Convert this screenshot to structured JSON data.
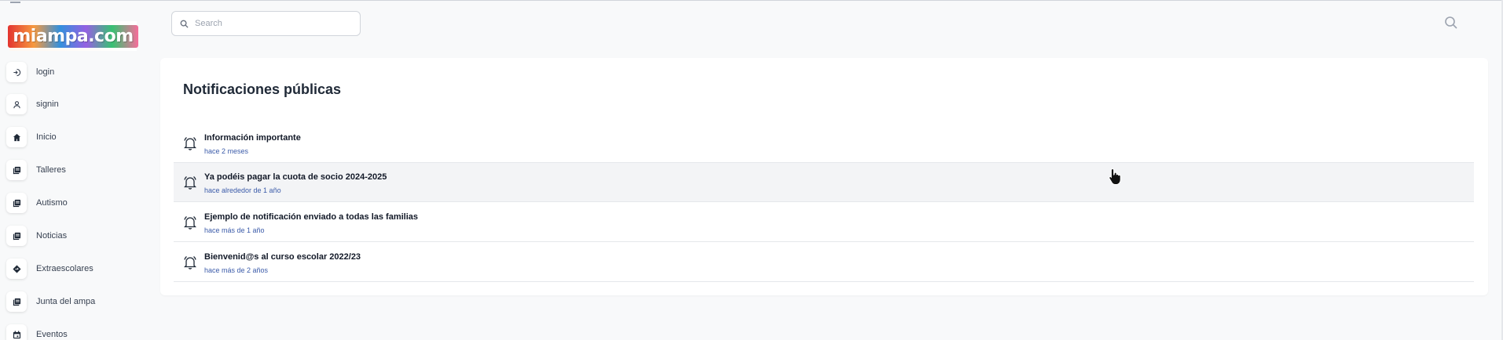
{
  "app": {
    "logo_text": "miampa.com"
  },
  "sidebar": {
    "items": [
      {
        "label": "login",
        "icon": "login-icon"
      },
      {
        "label": "signin",
        "icon": "user-icon"
      },
      {
        "label": "Inicio",
        "icon": "home-icon"
      },
      {
        "label": "Talleres",
        "icon": "book-icon"
      },
      {
        "label": "Autismo",
        "icon": "book-icon"
      },
      {
        "label": "Noticias",
        "icon": "book-icon"
      },
      {
        "label": "Extraescolares",
        "icon": "direction-icon"
      },
      {
        "label": "Junta del ampa",
        "icon": "book-icon"
      },
      {
        "label": "Eventos",
        "icon": "calendar-icon"
      }
    ]
  },
  "header": {
    "search_placeholder": "Search"
  },
  "main": {
    "title": "Notificaciones públicas",
    "notifications": [
      {
        "title": "Información importante",
        "time": "hace 2 meses"
      },
      {
        "title": "Ya podéis pagar la cuota de socio 2024-2025",
        "time": "hace alrededor de 1 año"
      },
      {
        "title": "Ejemplo de notificación enviado a todas las familias",
        "time": "hace más de 1 año"
      },
      {
        "title": "Bienvenid@s al curso escolar 2022/23",
        "time": "hace más de 2 años"
      }
    ]
  },
  "colors": {
    "accent_time": "#3b5ba9",
    "background": "#f8f9fa",
    "card": "#ffffff"
  }
}
